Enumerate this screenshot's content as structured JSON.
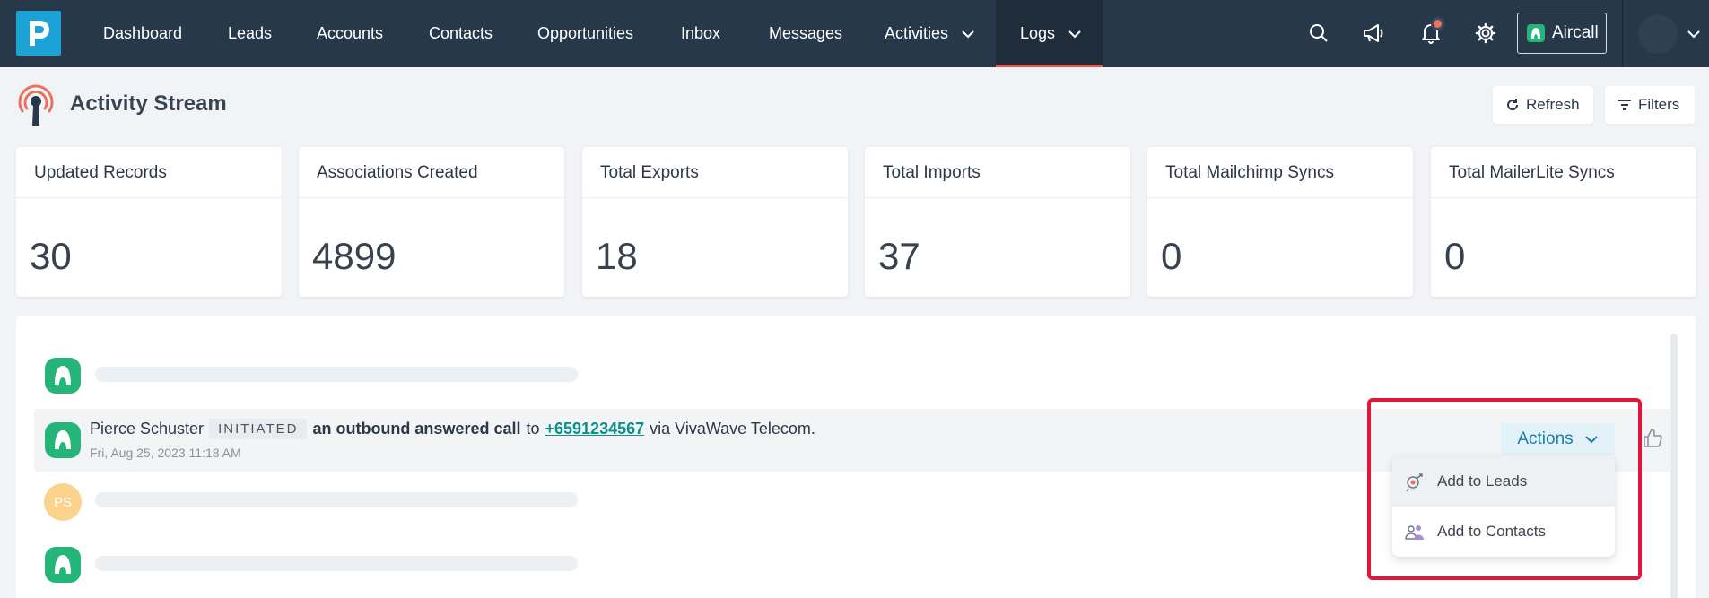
{
  "nav": {
    "items": [
      {
        "label": "Dashboard"
      },
      {
        "label": "Leads"
      },
      {
        "label": "Accounts"
      },
      {
        "label": "Contacts"
      },
      {
        "label": "Opportunities"
      },
      {
        "label": "Inbox"
      },
      {
        "label": "Messages"
      },
      {
        "label": "Activities"
      },
      {
        "label": "Logs"
      }
    ],
    "active": "Logs",
    "aircall_label": "Aircall",
    "accent_color": "#e8584a",
    "bg_color": "#27384a"
  },
  "page": {
    "title": "Activity Stream",
    "refresh_label": "Refresh",
    "filters_label": "Filters"
  },
  "stats": [
    {
      "title": "Updated Records",
      "value": "30"
    },
    {
      "title": "Associations Created",
      "value": "4899"
    },
    {
      "title": "Total Exports",
      "value": "18"
    },
    {
      "title": "Total Imports",
      "value": "37"
    },
    {
      "title": "Total Mailchimp Syncs",
      "value": "0"
    },
    {
      "title": "Total MailerLite Syncs",
      "value": "0"
    }
  ],
  "activity": {
    "user": "Pierce Schuster",
    "status": "INITIATED",
    "action": "an outbound answered call",
    "to_text": "to",
    "phone": "+6591234567",
    "via_text": "via VivaWave Telecom.",
    "timestamp": "Fri, Aug 25, 2023 11:18 AM",
    "avatar_initials": "PS"
  },
  "actions": {
    "label": "Actions",
    "menu": [
      {
        "label": "Add to Leads"
      },
      {
        "label": "Add to Contacts"
      }
    ]
  }
}
